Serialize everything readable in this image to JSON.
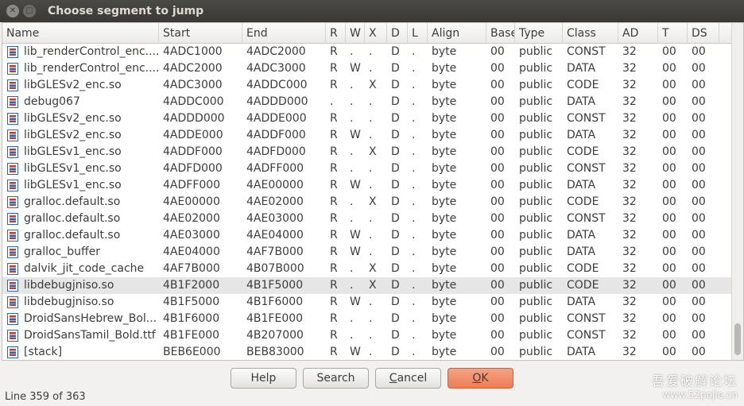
{
  "window": {
    "title": "Choose segment to jump",
    "close_glyph": "✕",
    "max_glyph": "□"
  },
  "table": {
    "columns": [
      "Name",
      "Start",
      "End",
      "R",
      "W",
      "X",
      "D",
      "L",
      "Align",
      "Base",
      "Type",
      "Class",
      "AD",
      "T",
      "DS"
    ],
    "selected_row": 14,
    "rows": [
      [
        "lib_renderControl_enc....",
        "4ADC1000",
        "4ADC2000",
        "R",
        ".",
        ".",
        "D",
        ".",
        "byte",
        "00",
        "public",
        "CONST",
        "32",
        "00",
        "00"
      ],
      [
        "lib_renderControl_enc....",
        "4ADC2000",
        "4ADC3000",
        "R",
        "W",
        ".",
        "D",
        ".",
        "byte",
        "00",
        "public",
        "DATA",
        "32",
        "00",
        "00"
      ],
      [
        "libGLESv2_enc.so",
        "4ADC3000",
        "4ADDC000",
        "R",
        ".",
        "X",
        "D",
        ".",
        "byte",
        "00",
        "public",
        "CODE",
        "32",
        "00",
        "00"
      ],
      [
        "debug067",
        "4ADDC000",
        "4ADDD000",
        ".",
        ".",
        ".",
        "D",
        ".",
        "byte",
        "00",
        "public",
        "DATA",
        "32",
        "00",
        "00"
      ],
      [
        "libGLESv2_enc.so",
        "4ADDD000",
        "4ADDE000",
        "R",
        ".",
        ".",
        "D",
        ".",
        "byte",
        "00",
        "public",
        "CONST",
        "32",
        "00",
        "00"
      ],
      [
        "libGLESv2_enc.so",
        "4ADDE000",
        "4ADDF000",
        "R",
        "W",
        ".",
        "D",
        ".",
        "byte",
        "00",
        "public",
        "DATA",
        "32",
        "00",
        "00"
      ],
      [
        "libGLESv1_enc.so",
        "4ADDF000",
        "4ADFD000",
        "R",
        ".",
        "X",
        "D",
        ".",
        "byte",
        "00",
        "public",
        "CODE",
        "32",
        "00",
        "00"
      ],
      [
        "libGLESv1_enc.so",
        "4ADFD000",
        "4ADFF000",
        "R",
        ".",
        ".",
        "D",
        ".",
        "byte",
        "00",
        "public",
        "CONST",
        "32",
        "00",
        "00"
      ],
      [
        "libGLESv1_enc.so",
        "4ADFF000",
        "4AE00000",
        "R",
        "W",
        ".",
        "D",
        ".",
        "byte",
        "00",
        "public",
        "DATA",
        "32",
        "00",
        "00"
      ],
      [
        "gralloc.default.so",
        "4AE00000",
        "4AE02000",
        "R",
        ".",
        "X",
        "D",
        ".",
        "byte",
        "00",
        "public",
        "CODE",
        "32",
        "00",
        "00"
      ],
      [
        "gralloc.default.so",
        "4AE02000",
        "4AE03000",
        "R",
        ".",
        ".",
        "D",
        ".",
        "byte",
        "00",
        "public",
        "CONST",
        "32",
        "00",
        "00"
      ],
      [
        "gralloc.default.so",
        "4AE03000",
        "4AE04000",
        "R",
        "W",
        ".",
        "D",
        ".",
        "byte",
        "00",
        "public",
        "DATA",
        "32",
        "00",
        "00"
      ],
      [
        "gralloc_buffer",
        "4AE04000",
        "4AF7B000",
        "R",
        "W",
        ".",
        "D",
        ".",
        "byte",
        "00",
        "public",
        "DATA",
        "32",
        "00",
        "00"
      ],
      [
        "dalvik_jit_code_cache",
        "4AF7B000",
        "4B07B000",
        "R",
        ".",
        "X",
        "D",
        ".",
        "byte",
        "00",
        "public",
        "CODE",
        "32",
        "00",
        "00"
      ],
      [
        "libdebugjniso.so",
        "4B1F2000",
        "4B1F5000",
        "R",
        ".",
        "X",
        "D",
        ".",
        "byte",
        "00",
        "public",
        "CODE",
        "32",
        "00",
        "00"
      ],
      [
        "libdebugjniso.so",
        "4B1F5000",
        "4B1F6000",
        "R",
        "W",
        ".",
        "D",
        ".",
        "byte",
        "00",
        "public",
        "DATA",
        "32",
        "00",
        "00"
      ],
      [
        "DroidSansHebrew_Bol...",
        "4B1F6000",
        "4B1FE000",
        "R",
        ".",
        ".",
        "D",
        ".",
        "byte",
        "00",
        "public",
        "CONST",
        "32",
        "00",
        "00"
      ],
      [
        "DroidSansTamil_Bold.ttf",
        "4B1FE000",
        "4B207000",
        "R",
        ".",
        ".",
        "D",
        ".",
        "byte",
        "00",
        "public",
        "CONST",
        "32",
        "00",
        "00"
      ],
      [
        "[stack]",
        "BEB6E000",
        "BEB83000",
        "R",
        "W",
        ".",
        "D",
        ".",
        "byte",
        "00",
        "public",
        "DATA",
        "32",
        "00",
        "00"
      ]
    ]
  },
  "buttons": {
    "help": "Help",
    "search": "Search",
    "cancel_pre": "",
    "cancel_u": "C",
    "cancel_post": "ancel",
    "ok_u": "O",
    "ok_post": "K"
  },
  "status": {
    "text": "Line 359 of 363"
  },
  "watermark": {
    "line1": "吾爱破解论坛",
    "line2": "www.52pojie.cn"
  }
}
